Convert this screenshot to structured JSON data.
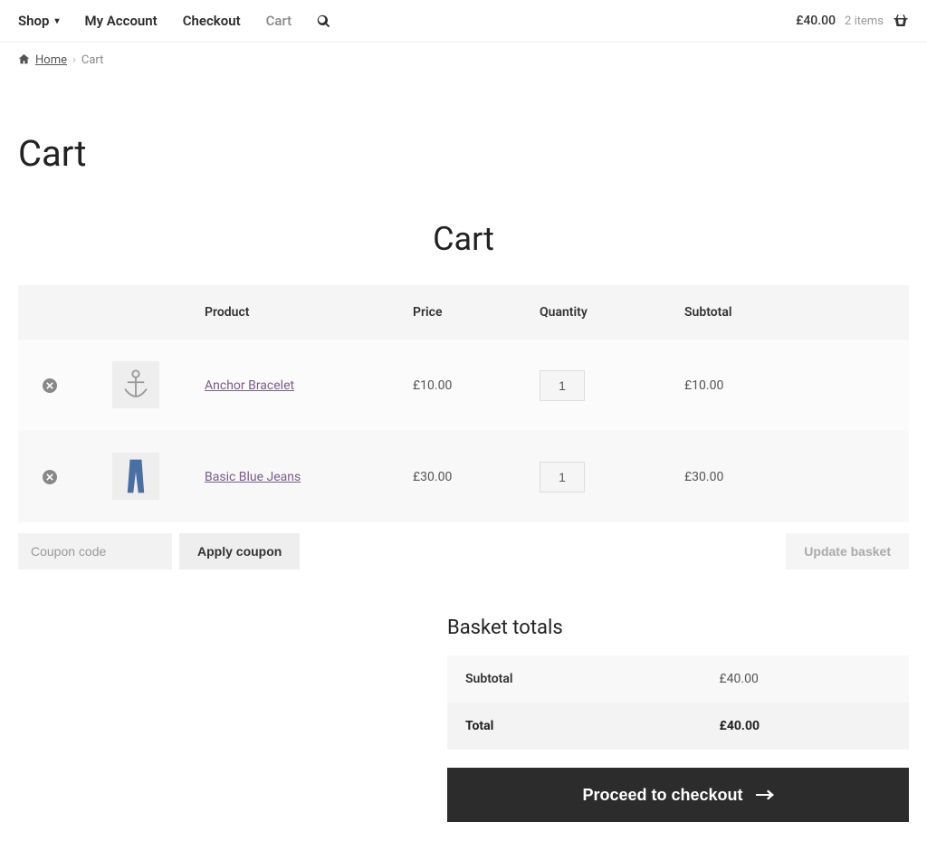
{
  "nav": {
    "shop": "Shop",
    "my_account": "My Account",
    "checkout": "Checkout",
    "cart": "Cart"
  },
  "cart_mini": {
    "amount": "£40.00",
    "count": "2 items"
  },
  "breadcrumb": {
    "home": "Home",
    "current": "Cart"
  },
  "page": {
    "title": "Cart",
    "section_title": "Cart"
  },
  "table": {
    "headers": {
      "product": "Product",
      "price": "Price",
      "quantity": "Quantity",
      "subtotal": "Subtotal"
    },
    "items": [
      {
        "name": "Anchor Bracelet",
        "price": "£10.00",
        "qty": "1",
        "subtotal": "£10.00"
      },
      {
        "name": "Basic Blue Jeans",
        "price": "£30.00",
        "qty": "1",
        "subtotal": "£30.00"
      }
    ]
  },
  "actions": {
    "coupon_placeholder": "Coupon code",
    "apply_coupon": "Apply coupon",
    "update_basket": "Update basket"
  },
  "totals": {
    "title": "Basket totals",
    "subtotal_label": "Subtotal",
    "subtotal_value": "£40.00",
    "total_label": "Total",
    "total_value": "£40.00"
  },
  "checkout_label": "Proceed to checkout"
}
